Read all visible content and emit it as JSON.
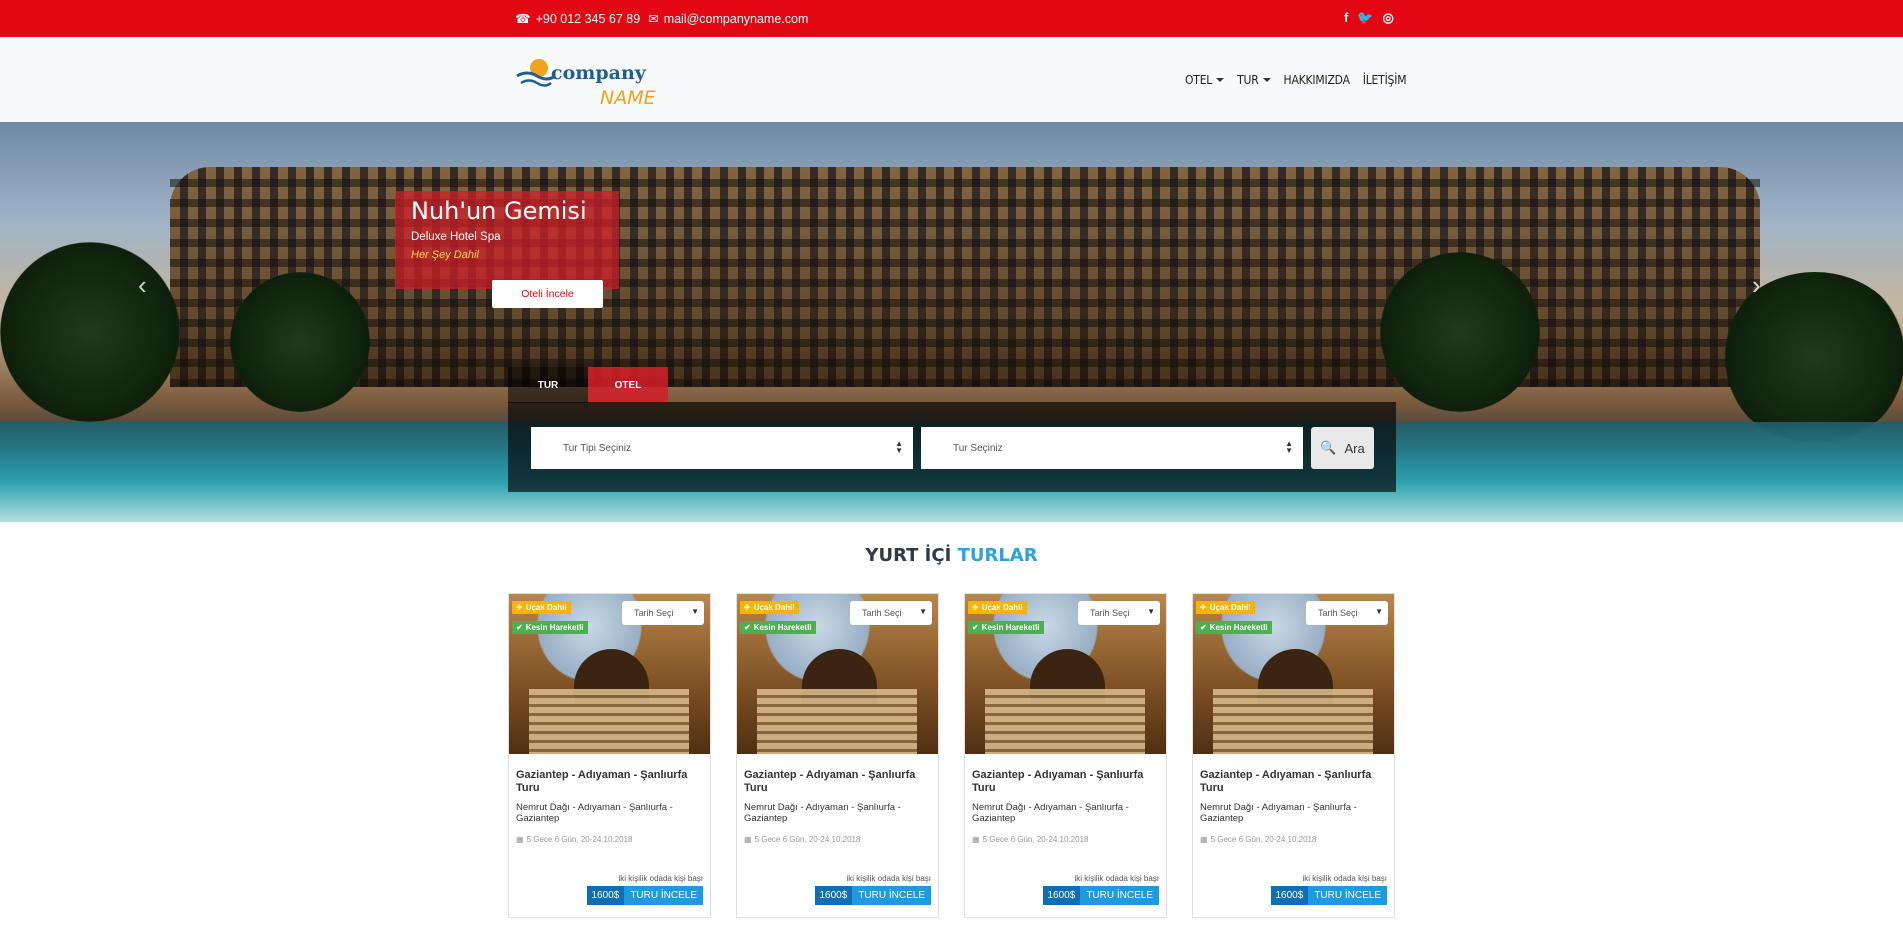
{
  "topbar": {
    "phone": "+90 012 345 67 89",
    "email": "mail@companyname.com",
    "social": [
      "facebook-icon",
      "twitter-icon",
      "instagram-icon"
    ]
  },
  "header": {
    "logo_word1": "company",
    "logo_word2": "NAME",
    "nav": [
      {
        "label": "OTEL",
        "dropdown": true
      },
      {
        "label": "TUR",
        "dropdown": true
      },
      {
        "label": "HAKKIMIZDA",
        "dropdown": false
      },
      {
        "label": "İLETİŞİM",
        "dropdown": false
      }
    ]
  },
  "hero": {
    "title": "Nuh'un Gemisi",
    "subtitle": "Deluxe Hotel Spa",
    "tagline": "Her Şey Dahil",
    "button": "Oteli İncele",
    "tabs": {
      "tur": "TUR",
      "otel": "OTEL"
    },
    "select1": "Tur Tipi Seçiniz",
    "select2": "Tur Seçiniz",
    "search_button": "Ara"
  },
  "section": {
    "title_part1": "YURT İÇİ",
    "title_part2": "TURLAR"
  },
  "cards": [
    {
      "badge1": "Uçak Dahil",
      "badge2": "Kesin Hareketli",
      "date_select": "Tarih Seçi",
      "title": "Gaziantep - Adıyaman - Şanlıurfa Turu",
      "route": "Nemrut Dağı - Adıyaman - Şanlıurfa - Gaziantep",
      "duration": "5 Gece 6 Gün, 20-24.10.2018",
      "per_person": "iki kişilik odada kişi başı",
      "price": "1600$",
      "button": "TURU İNCELE"
    },
    {
      "badge1": "Uçak Dahil",
      "badge2": "Kesin Hareketli",
      "date_select": "Tarih Seçi",
      "title": "Gaziantep - Adıyaman - Şanlıurfa Turu",
      "route": "Nemrut Dağı - Adıyaman - Şanlıurfa - Gaziantep",
      "duration": "5 Gece 6 Gün, 20-24.10.2018",
      "per_person": "iki kişilik odada kişi başı",
      "price": "1600$",
      "button": "TURU İNCELE"
    },
    {
      "badge1": "Uçak Dahil",
      "badge2": "Kesin Hareketli",
      "date_select": "Tarih Seçi",
      "title": "Gaziantep - Adıyaman - Şanlıurfa Turu",
      "route": "Nemrut Dağı - Adıyaman - Şanlıurfa - Gaziantep",
      "duration": "5 Gece 6 Gün, 20-24.10.2018",
      "per_person": "iki kişilik odada kişi başı",
      "price": "1600$",
      "button": "TURU İNCELE"
    },
    {
      "badge1": "Uçak Dahil",
      "badge2": "Kesin Hareketli",
      "date_select": "Tarih Seçi",
      "title": "Gaziantep - Adıyaman - Şanlıurfa Turu",
      "route": "Nemrut Dağı - Adıyaman - Şanlıurfa - Gaziantep",
      "duration": "5 Gece 6 Gün, 20-24.10.2018",
      "per_person": "iki kişilik odada kişi başı",
      "price": "1600$",
      "button": "TURU İNCELE"
    }
  ],
  "colors": {
    "brand_red": "#e30613",
    "accent_blue": "#2fa2d9",
    "price_blue": "#0e6fb5",
    "button_blue": "#1e9ae0"
  }
}
